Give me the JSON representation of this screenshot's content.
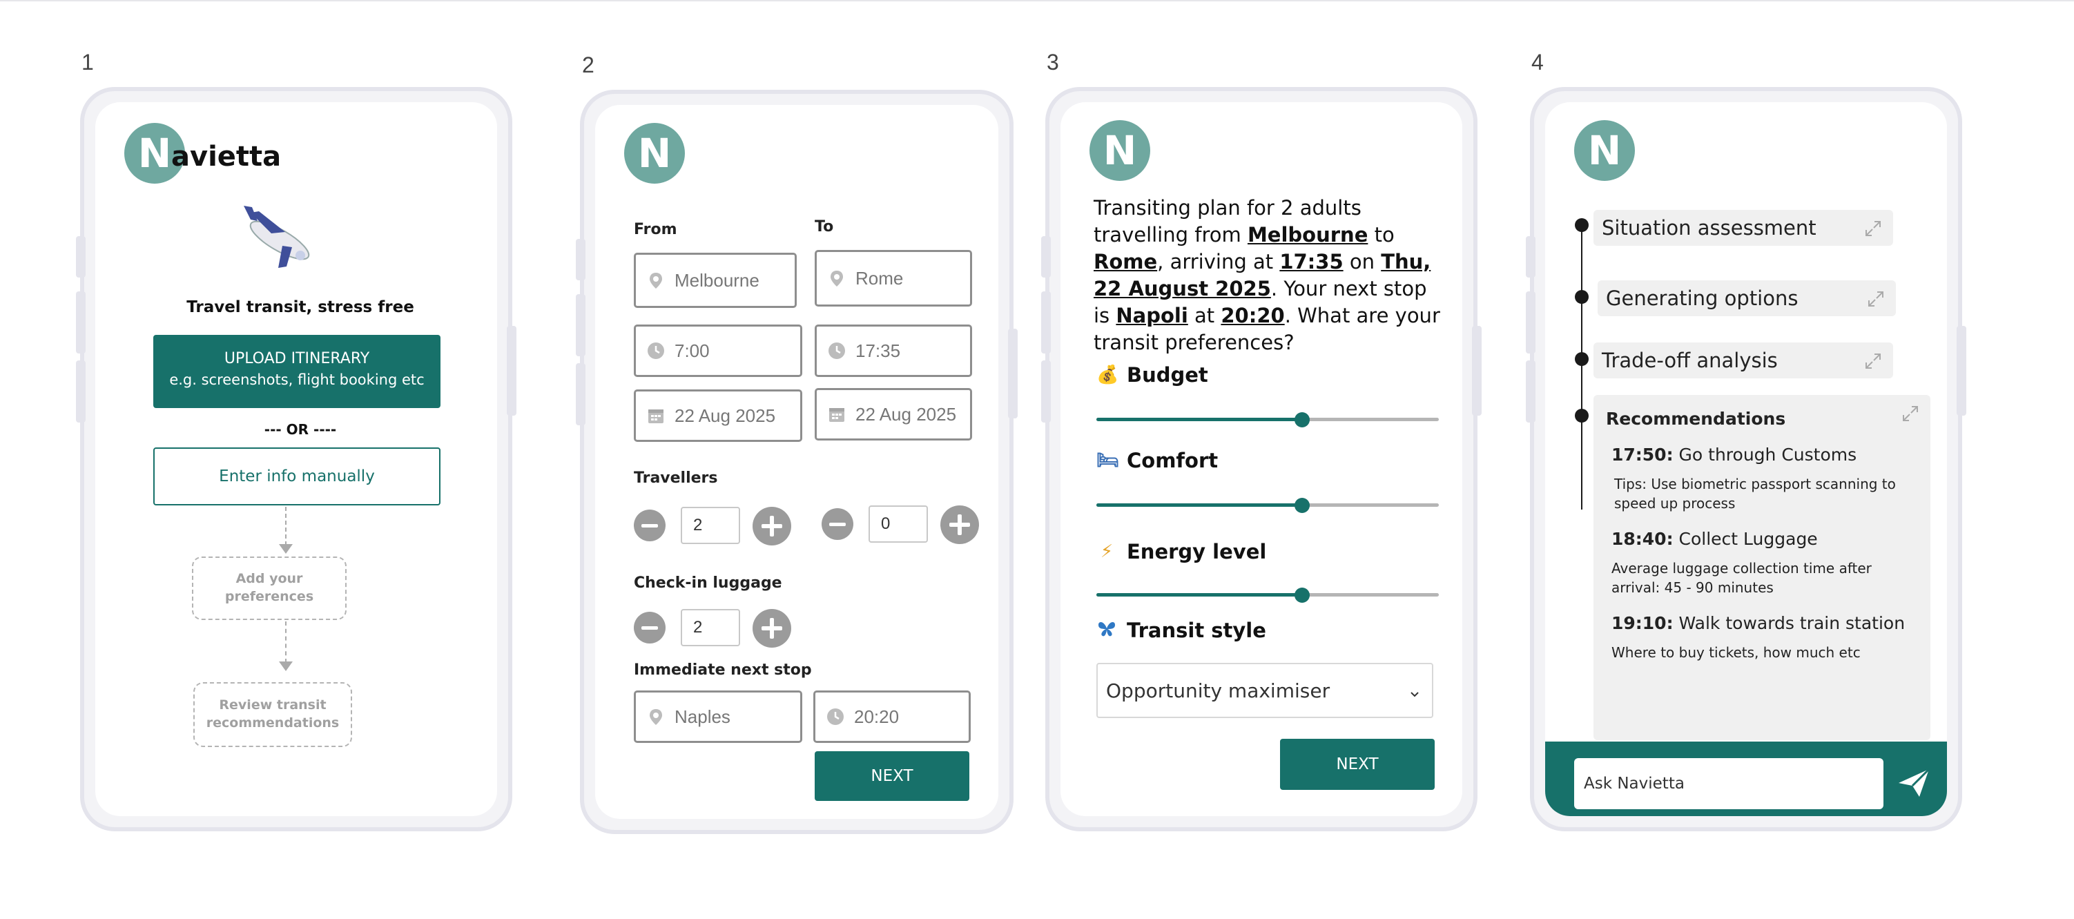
{
  "screens": [
    {
      "number": "1",
      "avatar_letter": "N",
      "app_name": "avietta",
      "tagline": "Travel transit, stress free",
      "upload_button": {
        "line1": "UPLOAD ITINERARY",
        "line2": "e.g. screenshots, flight booking etc"
      },
      "or_divider": "--- OR ----",
      "manual_button": "Enter info manually",
      "flow_steps": [
        "Add your preferences",
        "Review transit recommendations"
      ],
      "plane_icon": "airplane-icon"
    },
    {
      "number": "2",
      "avatar_letter": "N",
      "from_label": "From",
      "to_label": "To",
      "from_placeholder": "Melbourne",
      "to_placeholder": "Rome",
      "depart_time": "7:00",
      "arrive_time": "17:35",
      "depart_date": "22 Aug 2025",
      "arrive_date": "22 Aug 2025",
      "travellers_label": "Travellers",
      "adults_count": "2",
      "children_count": "0",
      "luggage_label": "Check-in luggage",
      "luggage_count": "2",
      "next_stop_label": "Immediate next stop",
      "next_stop_placeholder": "Naples",
      "next_stop_time": "20:20",
      "next_button": "NEXT"
    },
    {
      "number": "3",
      "avatar_letter": "N",
      "plan_text": {
        "p1": "Transiting plan for  2 adults travelling from ",
        "origin": "Melbourne",
        "p2": " to ",
        "destination": "Rome",
        "p3": ", arriving at ",
        "arrival_time": "17:35",
        "p4": " on ",
        "arrival_date": "Thu, 22 August 2025",
        "p5": ". Your next stop is ",
        "next_stop": "Napoli",
        "p6": " at ",
        "next_time": "20:20",
        "p7": ". What are your transit preferences?"
      },
      "preferences": [
        {
          "label": "Budget",
          "icon": "money-bag-icon",
          "glyph": "💰",
          "value_fraction": 0.6
        },
        {
          "label": "Comfort",
          "icon": "bed-icon",
          "glyph": "🛏",
          "value_fraction": 0.6
        },
        {
          "label": "Energy level",
          "icon": "lightning-icon",
          "glyph": "⚡",
          "value_fraction": 0.6
        }
      ],
      "transit_style_label": "Transit style",
      "transit_style_icon": "butterfly-icon",
      "transit_style_value": "Opportunity maximiser",
      "next_button": "NEXT",
      "colors": {
        "slider_fill": "#17716a",
        "slider_track": "#b5b5b5"
      }
    },
    {
      "number": "4",
      "avatar_letter": "N",
      "steps": [
        "Situation assessment",
        "Generating options",
        "Trade-off analysis"
      ],
      "recommendations_title": "Recommendations",
      "recommendations": [
        {
          "time": "17:50:",
          "action": "Go through Customs",
          "tip": "Tips: Use biometric passport scanning to speed up process"
        },
        {
          "time": "18:40:",
          "action": "Collect Luggage",
          "tip": "Average luggage collection time after arrival: 45 - 90 minutes"
        },
        {
          "time": "19:10:",
          "action": "Walk towards train station",
          "tip": "Where to buy tickets, how much etc"
        }
      ],
      "chat_placeholder": "Ask Navietta",
      "send_icon": "send-icon"
    }
  ],
  "colors": {
    "brand_teal": "#17716a",
    "avatar": "#6fa8a0",
    "phone_frame": "#e4e4ec"
  }
}
